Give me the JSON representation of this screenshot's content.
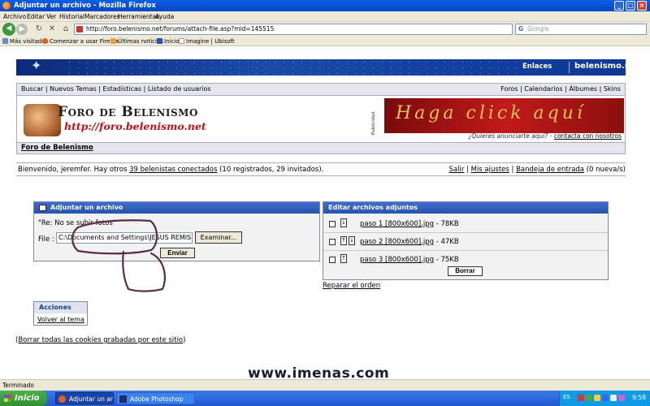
{
  "window": {
    "title": "Adjuntar un archivo - Mozilla Firefox"
  },
  "menu": [
    "Archivo",
    "Editar",
    "Ver",
    "Historial",
    "Marcadores",
    "Herramientas",
    "Ayuda"
  ],
  "nav": {
    "url": "http://foro.belenismo.net/forums/attach-file.asp?mid=145515",
    "search_placeholder": "Google"
  },
  "bookmarks": [
    "Más visitados",
    "Comenzar a usar Firefox",
    "Últimas noticias",
    "Inicio",
    "Imagine | Ubisoft"
  ],
  "site": {
    "top_links": {
      "enlaces": "Enlaces",
      "brand": "belenismo.net"
    },
    "nav_left": "Buscar | Nuevos Temas | Estadísticas | Listado de usuarios",
    "nav_right": "Foros | Calendarios | Álbumes | Skins",
    "logo_title": "Foro de Belenismo",
    "logo_url": "http://foro.belenismo.net",
    "ad_label": "Publicidad",
    "ad_text": "Haga click aquí",
    "ad_question": "¿Quieres anunciarte aquí? -",
    "ad_contact": "contacta con nosotros",
    "forum_crumb": "Foro de Belenismo",
    "welcome_pre": "Bienvenido, jeremfer. Hay otros",
    "welcome_link": "39 belenistas conectados",
    "welcome_post": "(10 registrados, 29 invitados).",
    "user_links": {
      "salir": "Salir",
      "ajustes": "Mis ajustes",
      "bandeja": "Bandeja de entrada",
      "bandeja_count": "(0 nueva/s)"
    }
  },
  "upload": {
    "header": "Adjuntar un archivo",
    "reply_title": "\"Re: No se subir fotos\"",
    "file_label": "File :",
    "file_value": "C:\\Documents and Settings\\JESUS REMIS",
    "browse": "Examinar...",
    "send": "Enviar"
  },
  "edit": {
    "header": "Editar archivos adjuntos",
    "files": [
      {
        "name": "paso 1 [800x600].jpg",
        "size": "- 78KB"
      },
      {
        "name": "paso 2 [800x600].jpg",
        "size": "- 47KB"
      },
      {
        "name": "paso 3 [800x600].jpg",
        "size": "- 75KB"
      }
    ],
    "delete": "Borrar",
    "reorder": "Reparar el orden"
  },
  "actions": {
    "header": "Acciones",
    "back": "Volver al tema"
  },
  "cookies": {
    "open": "(",
    "link": "Borrar todas las cookies grabadas por este sitio",
    "close": ")"
  },
  "watermark": "www.imenas.com",
  "status": "Terminado",
  "taskbar": {
    "start": "Inicio",
    "tasks": [
      "Adjuntar un arc...",
      "Adobe Photoshop"
    ],
    "lang": "ES",
    "clock": "9:58"
  },
  "colors": {
    "accent": "#2853ad",
    "annotation": "#5b2d45",
    "ad": "#c21a1a"
  }
}
